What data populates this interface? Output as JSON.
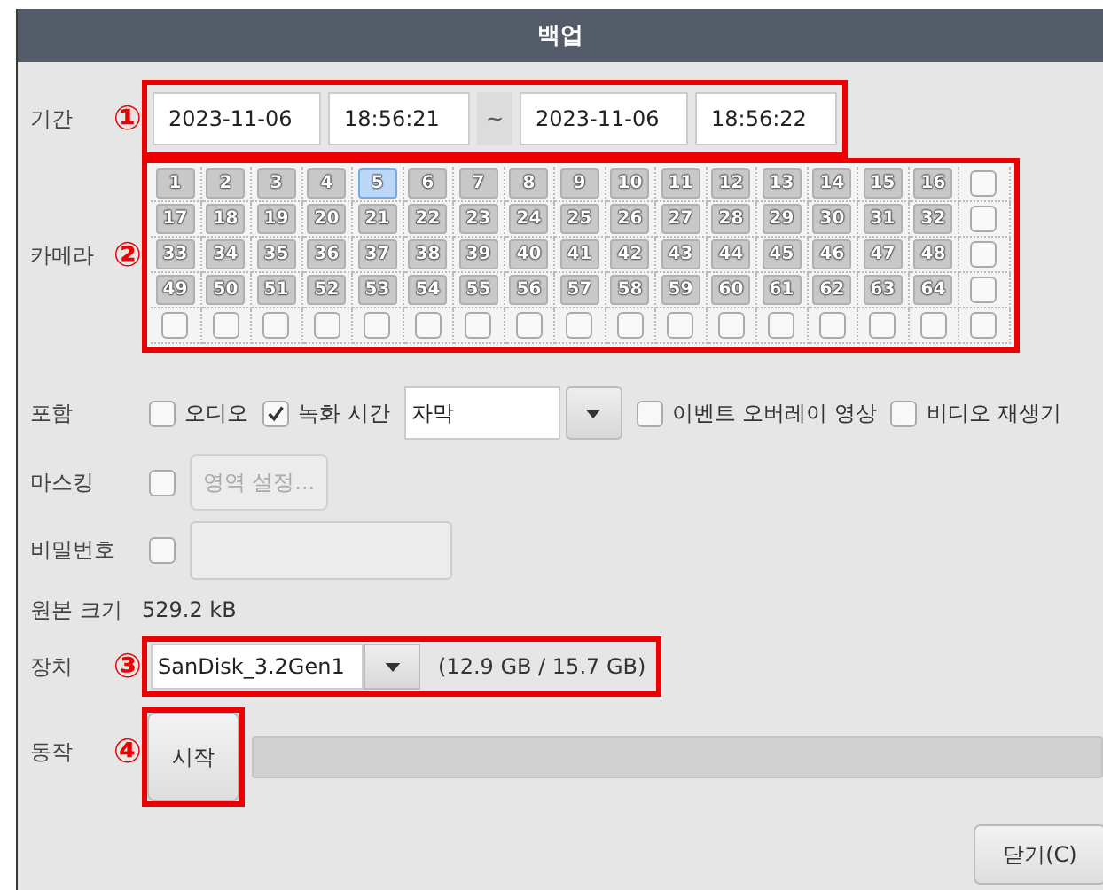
{
  "window": {
    "title": "백업"
  },
  "period": {
    "label": "기간",
    "annotation": "①",
    "start_date": "2023-11-06",
    "start_time": "18:56:21",
    "separator": "~",
    "end_date": "2023-11-06",
    "end_time": "18:56:22"
  },
  "camera": {
    "label": "카메라",
    "annotation": "②",
    "cameras": [
      {
        "label": "1",
        "selected": false
      },
      {
        "label": "2",
        "selected": false
      },
      {
        "label": "3",
        "selected": false
      },
      {
        "label": "4",
        "selected": false
      },
      {
        "label": "5",
        "selected": true
      },
      {
        "label": "6",
        "selected": false
      },
      {
        "label": "7",
        "selected": false
      },
      {
        "label": "8",
        "selected": false
      },
      {
        "label": "9",
        "selected": false
      },
      {
        "label": "10",
        "selected": false
      },
      {
        "label": "11",
        "selected": false
      },
      {
        "label": "12",
        "selected": false
      },
      {
        "label": "13",
        "selected": false
      },
      {
        "label": "14",
        "selected": false
      },
      {
        "label": "15",
        "selected": false
      },
      {
        "label": "16",
        "selected": false
      },
      {
        "label": "17",
        "selected": false
      },
      {
        "label": "18",
        "selected": false
      },
      {
        "label": "19",
        "selected": false
      },
      {
        "label": "20",
        "selected": false
      },
      {
        "label": "21",
        "selected": false
      },
      {
        "label": "22",
        "selected": false
      },
      {
        "label": "23",
        "selected": false
      },
      {
        "label": "24",
        "selected": false
      },
      {
        "label": "25",
        "selected": false
      },
      {
        "label": "26",
        "selected": false
      },
      {
        "label": "27",
        "selected": false
      },
      {
        "label": "28",
        "selected": false
      },
      {
        "label": "29",
        "selected": false
      },
      {
        "label": "30",
        "selected": false
      },
      {
        "label": "31",
        "selected": false
      },
      {
        "label": "32",
        "selected": false
      },
      {
        "label": "33",
        "selected": false
      },
      {
        "label": "34",
        "selected": false
      },
      {
        "label": "35",
        "selected": false
      },
      {
        "label": "36",
        "selected": false
      },
      {
        "label": "37",
        "selected": false
      },
      {
        "label": "38",
        "selected": false
      },
      {
        "label": "39",
        "selected": false
      },
      {
        "label": "40",
        "selected": false
      },
      {
        "label": "41",
        "selected": false
      },
      {
        "label": "42",
        "selected": false
      },
      {
        "label": "43",
        "selected": false
      },
      {
        "label": "44",
        "selected": false
      },
      {
        "label": "45",
        "selected": false
      },
      {
        "label": "46",
        "selected": false
      },
      {
        "label": "47",
        "selected": false
      },
      {
        "label": "48",
        "selected": false
      },
      {
        "label": "49",
        "selected": false
      },
      {
        "label": "50",
        "selected": false
      },
      {
        "label": "51",
        "selected": false
      },
      {
        "label": "52",
        "selected": false
      },
      {
        "label": "53",
        "selected": false
      },
      {
        "label": "54",
        "selected": false
      },
      {
        "label": "55",
        "selected": false
      },
      {
        "label": "56",
        "selected": false
      },
      {
        "label": "57",
        "selected": false
      },
      {
        "label": "58",
        "selected": false
      },
      {
        "label": "59",
        "selected": false
      },
      {
        "label": "60",
        "selected": false
      },
      {
        "label": "61",
        "selected": false
      },
      {
        "label": "62",
        "selected": false
      },
      {
        "label": "63",
        "selected": false
      },
      {
        "label": "64",
        "selected": false
      }
    ],
    "row_checks": [
      {
        "checked": false
      },
      {
        "checked": false
      },
      {
        "checked": false
      },
      {
        "checked": false
      }
    ],
    "column_checks": [
      {
        "checked": false
      },
      {
        "checked": false
      },
      {
        "checked": false
      },
      {
        "checked": false
      },
      {
        "checked": false
      },
      {
        "checked": false
      },
      {
        "checked": false
      },
      {
        "checked": false
      },
      {
        "checked": false
      },
      {
        "checked": false
      },
      {
        "checked": false
      },
      {
        "checked": false
      },
      {
        "checked": false
      },
      {
        "checked": false
      },
      {
        "checked": false
      },
      {
        "checked": false
      },
      {
        "checked": false
      }
    ]
  },
  "include": {
    "label": "포함",
    "options": [
      {
        "kind": "checkbox",
        "label": "오디오",
        "checked": false
      },
      {
        "kind": "checkbox",
        "label": "녹화 시간",
        "checked": true
      },
      {
        "kind": "combo",
        "value": "자막"
      },
      {
        "kind": "checkbox",
        "label": "이벤트 오버레이 영상",
        "checked": false
      },
      {
        "kind": "checkbox",
        "label": "비디오 재생기",
        "checked": false
      }
    ]
  },
  "masking": {
    "label": "마스킹",
    "checked": false,
    "button": {
      "label": "영역 설정...",
      "disabled": true
    }
  },
  "password": {
    "label": "비밀번호",
    "checked": false
  },
  "source_size": {
    "label": "원본 크기",
    "value": "529.2 kB"
  },
  "device": {
    "label": "장치",
    "annotation": "③",
    "value": "SanDisk_3.2Gen1",
    "capacity": "(12.9 GB / 15.7 GB)"
  },
  "action": {
    "label": "동작",
    "annotation": "④",
    "button": "시작",
    "progress": {
      "level": 0
    }
  },
  "buttons": [
    "닫기(C)"
  ]
}
